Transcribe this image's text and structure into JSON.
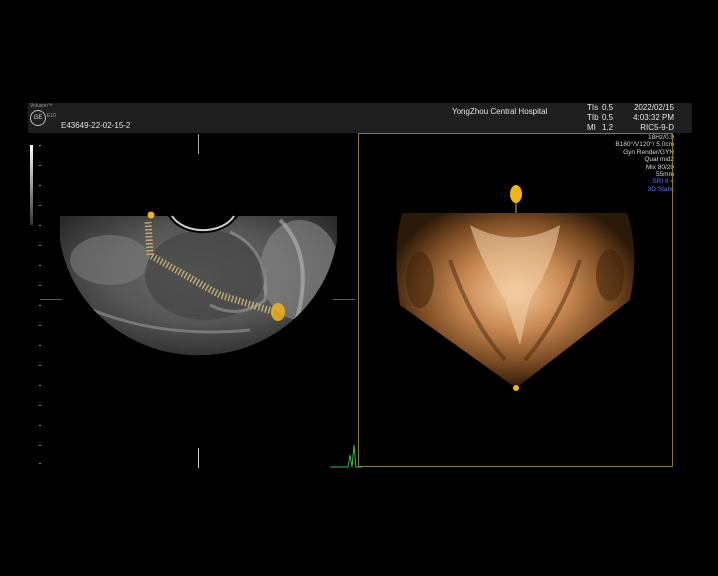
{
  "header": {
    "logo_text": "Voluson™",
    "brand_mark": "GE",
    "logo_suffix": "E10",
    "patient_id": "E43649-22-02-15-2",
    "hospital": "YongZhou Central Hospital",
    "tis": {
      "label": "TIs",
      "value": "0.5"
    },
    "tib": {
      "label": "TIb",
      "value": "0.5"
    },
    "mi": {
      "label": "MI",
      "value": "1.2"
    },
    "date": "2022/02/15",
    "time": "4:03:32 PM",
    "probe": "RIC5-9-D"
  },
  "params": {
    "line1": "18Hz/0.9",
    "line2": "B180°/V120°/ 5.0cm",
    "line3": "Gyn Render/GYN",
    "line4": "Qual mid2",
    "line5": "Mix 80/20",
    "line6": "55mm",
    "line7": "SRI II 4",
    "line8": "3D Static"
  },
  "colors": {
    "frame": "#8a7a2c",
    "marker": "#f2b21a",
    "accent_blue": "#5a73ff",
    "red_marker": "#b23b2c"
  }
}
